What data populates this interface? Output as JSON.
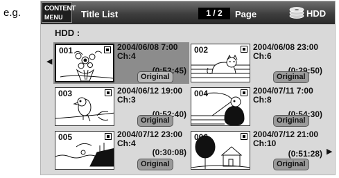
{
  "caption": "e.g.",
  "header": {
    "menu_line1": "CONTENT",
    "menu_line2": "MENU",
    "title": "Title List",
    "page_indicator": "1 / 2",
    "page_label": "Page",
    "drive_label": "HDD",
    "icons": {
      "drive": "hdd-disk-icon"
    }
  },
  "hdd_heading": "HDD :",
  "nav": {
    "left_arrow": "◀",
    "right_arrow": "▶"
  },
  "titles": [
    {
      "number": "001",
      "datetime": "2004/06/08  7:00",
      "channel": "Ch:4",
      "duration": "(0:53:45)",
      "button": "Original",
      "selected": true
    },
    {
      "number": "002",
      "datetime": "2004/06/08 23:00",
      "channel": "Ch:6",
      "duration": "(0:29:50)",
      "button": "Original",
      "selected": false
    },
    {
      "number": "003",
      "datetime": "2004/06/12 19:00",
      "channel": "Ch:3",
      "duration": "(0:52:40)",
      "button": "Original",
      "selected": false
    },
    {
      "number": "004",
      "datetime": "2004/07/11  7:00",
      "channel": "Ch:8",
      "duration": "(0:54:30)",
      "button": "Original",
      "selected": false
    },
    {
      "number": "005",
      "datetime": "2004/07/12 23:00",
      "channel": "Ch:4",
      "duration": "(0:30:08)",
      "button": "Original",
      "selected": false
    },
    {
      "number": "006",
      "datetime": "2004/07/12 21:00",
      "channel": "Ch:10",
      "duration": "(0:51:28)",
      "button": "Original",
      "selected": false
    }
  ]
}
